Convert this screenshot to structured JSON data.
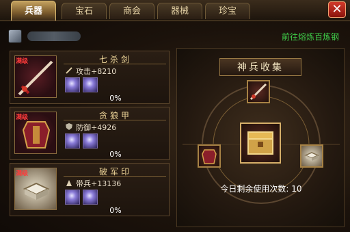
{
  "tabs": [
    "兵器",
    "宝石",
    "商会",
    "器械",
    "珍宝"
  ],
  "active_tab_index": 0,
  "close_icon": "close-icon",
  "info": {
    "goto_link": "前往熔炼百炼钢"
  },
  "items": [
    {
      "badge": "满级",
      "name": "七杀剑",
      "stat_label": "攻击",
      "stat_value": "+8210",
      "progress": "0%",
      "stat_icon": "sword-icon"
    },
    {
      "badge": "满级",
      "name": "贪狼甲",
      "stat_label": "防御",
      "stat_value": "+4926",
      "progress": "0%",
      "stat_icon": "shield-icon"
    },
    {
      "badge": "满级",
      "name": "破军印",
      "stat_label": "带兵",
      "stat_value": "+13136",
      "progress": "0%",
      "stat_icon": "troops-icon"
    }
  ],
  "collection": {
    "title": "神兵收集",
    "uses_label": "今日剩余使用次数:",
    "uses_value": "10"
  },
  "colors": {
    "accent_gold": "#d8b870",
    "link_green": "#3fd04a",
    "badge_red": "#ff3b3b"
  }
}
